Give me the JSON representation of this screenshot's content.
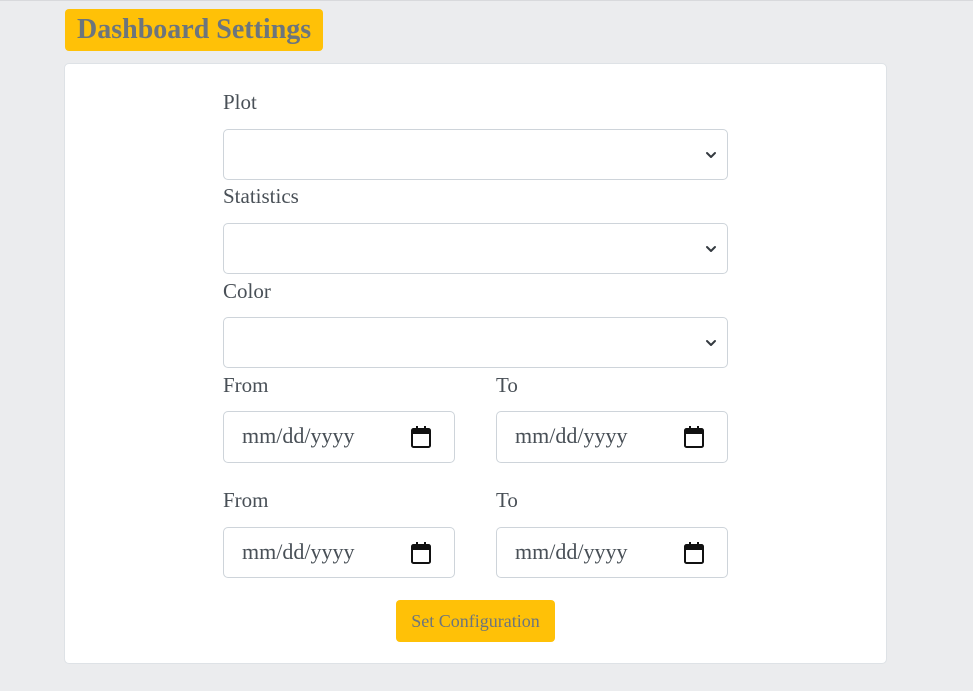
{
  "header": {
    "title": "Dashboard Settings"
  },
  "form": {
    "plot": {
      "label": "Plot",
      "value": ""
    },
    "statistics": {
      "label": "Statistics",
      "value": ""
    },
    "color": {
      "label": "Color",
      "value": ""
    },
    "range1": {
      "from_label": "From",
      "to_label": "To",
      "from_placeholder": "mm/dd/yyyy",
      "to_placeholder": "mm/dd/yyyy"
    },
    "range2": {
      "from_label": "From",
      "to_label": "To",
      "from_placeholder": "mm/dd/yyyy",
      "to_placeholder": "mm/dd/yyyy"
    },
    "submit_label": "Set Configuration"
  },
  "icons": {
    "select_arrow": "chevron-down-icon",
    "date_picker": "calendar-icon"
  },
  "colors": {
    "accent": "#ffc107",
    "title_text": "#6c757d",
    "page_background": "#ebecee",
    "card_background": "#ffffff",
    "input_border": "#ced4da"
  }
}
